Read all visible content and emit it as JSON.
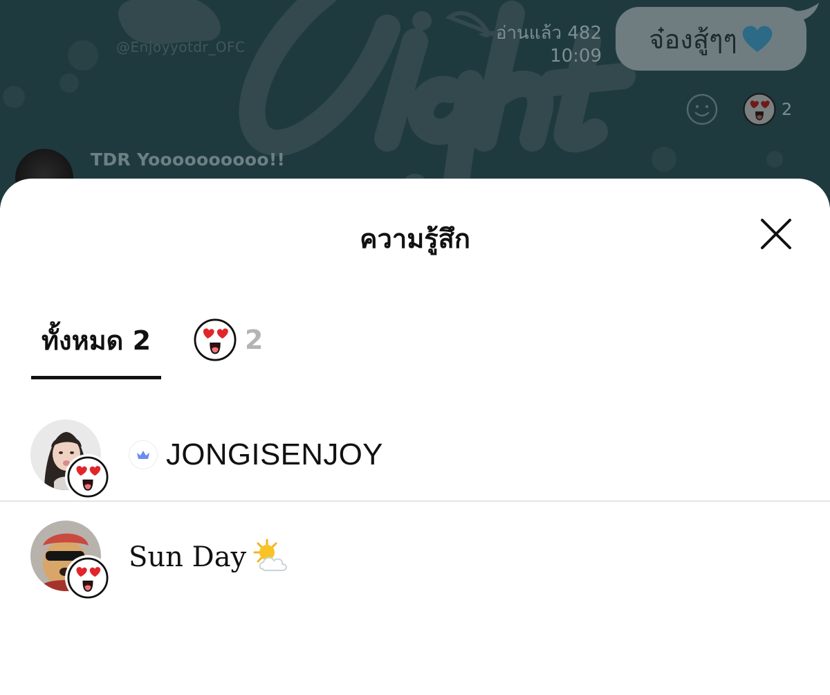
{
  "background_chat": {
    "wallpaper_handle": "@Enjoyyotdr_OFC",
    "read_status": "อ่านแล้ว 482",
    "time": "10:09",
    "message_text": "จ๋องสู้ๆๆ",
    "message_emoji": "blue-heart-icon",
    "reaction_count": "2",
    "sender_name": "TDR Yoooooooooo!!"
  },
  "sheet": {
    "title": "ความรู้สึก",
    "close_icon": "close-icon"
  },
  "tabs": {
    "all_label": "ทั้งหมด 2",
    "emoji_count": "2",
    "emoji_icon": "heart-eyes-face-icon"
  },
  "users": [
    {
      "name": "JONGISENJOY",
      "badge_icon": "crown-icon",
      "reaction_icon": "heart-eyes-face-icon"
    },
    {
      "name": "Sun Day",
      "name_emoji": "sun-behind-cloud-icon",
      "reaction_icon": "heart-eyes-face-icon"
    }
  ],
  "colors": {
    "background_overlay": "#1f3a3f",
    "tab_active": "#111111",
    "tab_inactive": "#b4b4b4",
    "crown": "#6b8cf0"
  }
}
